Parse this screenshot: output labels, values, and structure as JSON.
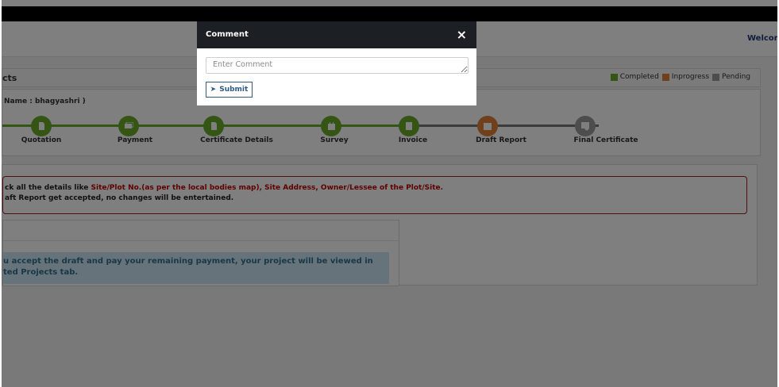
{
  "header": {
    "welcome": "Welcom"
  },
  "projects": {
    "title": "cts",
    "legend": [
      {
        "label": "Completed",
        "color": "#6aaa2a"
      },
      {
        "label": "Inprogress",
        "color": "#e0803a"
      },
      {
        "label": "Pending",
        "color": "#9b9b9b"
      }
    ]
  },
  "steps": {
    "name_label": "Name : bhagyashri )",
    "items": [
      {
        "label": "Quotation",
        "status": "completed",
        "icon": "document-icon"
      },
      {
        "label": "Payment",
        "status": "completed",
        "icon": "money-icon"
      },
      {
        "label": "Certificate Details",
        "status": "completed",
        "icon": "document-icon"
      },
      {
        "label": "Survey",
        "status": "completed",
        "icon": "calendar-icon"
      },
      {
        "label": "Invoice",
        "status": "completed",
        "icon": "invoice-icon"
      },
      {
        "label": "Draft Report",
        "status": "inprogress",
        "icon": "report-icon"
      },
      {
        "label": "Final Certificate",
        "status": "pending",
        "icon": "certificate-icon"
      }
    ]
  },
  "alert": {
    "line1_prefix": "ck all the details like ",
    "line1_highlight": "Site/Plot No.(as per the local bodies map), Site Address, Owner/Lessee of the Plot/Site.",
    "line2": "aft Report get accepted, no changes will be entertained."
  },
  "info": {
    "line1": "u accept the draft and pay your remaining payment, your project will be viewed in",
    "line2": "ted Projects tab."
  },
  "modal": {
    "title": "Comment",
    "close": "×",
    "comment_placeholder": "Enter Comment",
    "submit_label": "Submit",
    "submit_icon": "➤"
  }
}
